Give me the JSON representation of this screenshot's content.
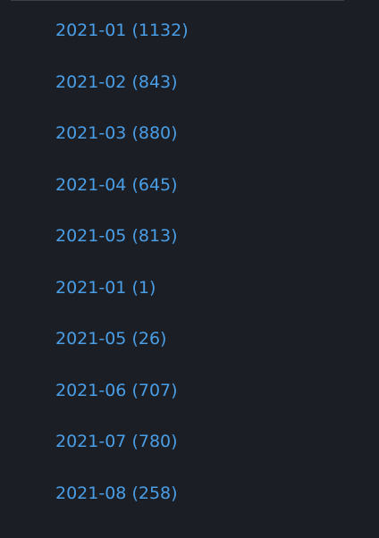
{
  "archive": {
    "items": [
      {
        "label": "2021-01",
        "count": "(1132)"
      },
      {
        "label": "2021-02",
        "count": "(843)"
      },
      {
        "label": "2021-03",
        "count": "(880)"
      },
      {
        "label": "2021-04",
        "count": "(645)"
      },
      {
        "label": "2021-05",
        "count": "(813)"
      },
      {
        "label": "2021-01",
        "count": "(1)"
      },
      {
        "label": "2021-05",
        "count": "(26)"
      },
      {
        "label": "2021-06",
        "count": "(707)"
      },
      {
        "label": "2021-07",
        "count": "(780)"
      },
      {
        "label": "2021-08",
        "count": "(258)"
      }
    ]
  },
  "colors": {
    "background": "#1b1e25",
    "link": "#4a9ee6",
    "divider": "#3a3f48"
  }
}
